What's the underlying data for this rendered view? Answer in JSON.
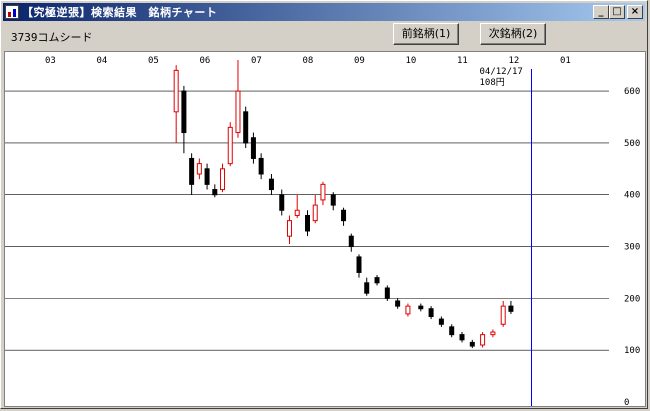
{
  "window": {
    "title": "【究極逆張】検索結果　銘柄チャート",
    "controls": {
      "minimize": "_",
      "maximize": "□",
      "close": "×"
    }
  },
  "toolbar": {
    "stock_label": "3739コムシード",
    "prev_button": "前銘柄(1)",
    "next_button": "次銘柄(2)"
  },
  "cursor": {
    "date": "04/12/17",
    "price": "108円"
  },
  "colors": {
    "up_candle": "#e00000",
    "down_candle": "#000000",
    "cursor_line": "#0000ff",
    "grid": "#000000"
  },
  "chart_data": {
    "type": "candlestick",
    "months": [
      "03",
      "04",
      "05",
      "06",
      "07",
      "08",
      "09",
      "10",
      "11",
      "12",
      "01"
    ],
    "y_ticks": [
      600,
      500,
      400,
      300,
      200,
      100,
      0
    ],
    "ylim": [
      0,
      660
    ],
    "cursor_month": "12",
    "series_points": [
      {
        "m": 5.45,
        "o": 560,
        "c": 640,
        "h": 650,
        "l": 500
      },
      {
        "m": 5.6,
        "o": 600,
        "c": 520,
        "h": 610,
        "l": 480
      },
      {
        "m": 5.75,
        "o": 470,
        "c": 420,
        "h": 480,
        "l": 400
      },
      {
        "m": 5.9,
        "o": 440,
        "c": 460,
        "h": 470,
        "l": 430
      },
      {
        "m": 6.05,
        "o": 450,
        "c": 420,
        "h": 460,
        "l": 410
      },
      {
        "m": 6.2,
        "o": 410,
        "c": 400,
        "h": 420,
        "l": 395
      },
      {
        "m": 6.35,
        "o": 410,
        "c": 450,
        "h": 460,
        "l": 405
      },
      {
        "m": 6.5,
        "o": 460,
        "c": 530,
        "h": 540,
        "l": 455
      },
      {
        "m": 6.65,
        "o": 520,
        "c": 600,
        "h": 660,
        "l": 510
      },
      {
        "m": 6.8,
        "o": 560,
        "c": 500,
        "h": 570,
        "l": 490
      },
      {
        "m": 6.95,
        "o": 510,
        "c": 470,
        "h": 520,
        "l": 460
      },
      {
        "m": 7.1,
        "o": 470,
        "c": 440,
        "h": 480,
        "l": 430
      },
      {
        "m": 7.3,
        "o": 430,
        "c": 410,
        "h": 440,
        "l": 400
      },
      {
        "m": 7.5,
        "o": 400,
        "c": 370,
        "h": 410,
        "l": 360
      },
      {
        "m": 7.65,
        "o": 320,
        "c": 350,
        "h": 360,
        "l": 305
      },
      {
        "m": 7.8,
        "o": 360,
        "c": 370,
        "h": 400,
        "l": 355
      },
      {
        "m": 8.0,
        "o": 360,
        "c": 330,
        "h": 370,
        "l": 320
      },
      {
        "m": 8.15,
        "o": 350,
        "c": 380,
        "h": 400,
        "l": 345
      },
      {
        "m": 8.3,
        "o": 390,
        "c": 420,
        "h": 425,
        "l": 380
      },
      {
        "m": 8.5,
        "o": 400,
        "c": 380,
        "h": 405,
        "l": 370
      },
      {
        "m": 8.7,
        "o": 370,
        "c": 350,
        "h": 375,
        "l": 340
      },
      {
        "m": 8.85,
        "o": 320,
        "c": 300,
        "h": 325,
        "l": 290
      },
      {
        "m": 9.0,
        "o": 280,
        "c": 250,
        "h": 285,
        "l": 240
      },
      {
        "m": 9.15,
        "o": 230,
        "c": 210,
        "h": 240,
        "l": 205
      },
      {
        "m": 9.35,
        "o": 240,
        "c": 230,
        "h": 245,
        "l": 225
      },
      {
        "m": 9.55,
        "o": 220,
        "c": 200,
        "h": 225,
        "l": 195
      },
      {
        "m": 9.75,
        "o": 195,
        "c": 185,
        "h": 200,
        "l": 180
      },
      {
        "m": 9.95,
        "o": 170,
        "c": 185,
        "h": 190,
        "l": 165
      },
      {
        "m": 10.2,
        "o": 185,
        "c": 180,
        "h": 190,
        "l": 175
      },
      {
        "m": 10.4,
        "o": 180,
        "c": 165,
        "h": 185,
        "l": 160
      },
      {
        "m": 10.6,
        "o": 160,
        "c": 150,
        "h": 165,
        "l": 145
      },
      {
        "m": 10.8,
        "o": 145,
        "c": 130,
        "h": 150,
        "l": 125
      },
      {
        "m": 11.0,
        "o": 130,
        "c": 120,
        "h": 135,
        "l": 115
      },
      {
        "m": 11.2,
        "o": 115,
        "c": 108,
        "h": 120,
        "l": 104
      },
      {
        "m": 11.4,
        "o": 110,
        "c": 130,
        "h": 135,
        "l": 105
      },
      {
        "m": 11.6,
        "o": 130,
        "c": 135,
        "h": 140,
        "l": 125
      },
      {
        "m": 11.8,
        "o": 150,
        "c": 185,
        "h": 195,
        "l": 145
      },
      {
        "m": 11.95,
        "o": 185,
        "c": 175,
        "h": 195,
        "l": 170
      }
    ]
  }
}
